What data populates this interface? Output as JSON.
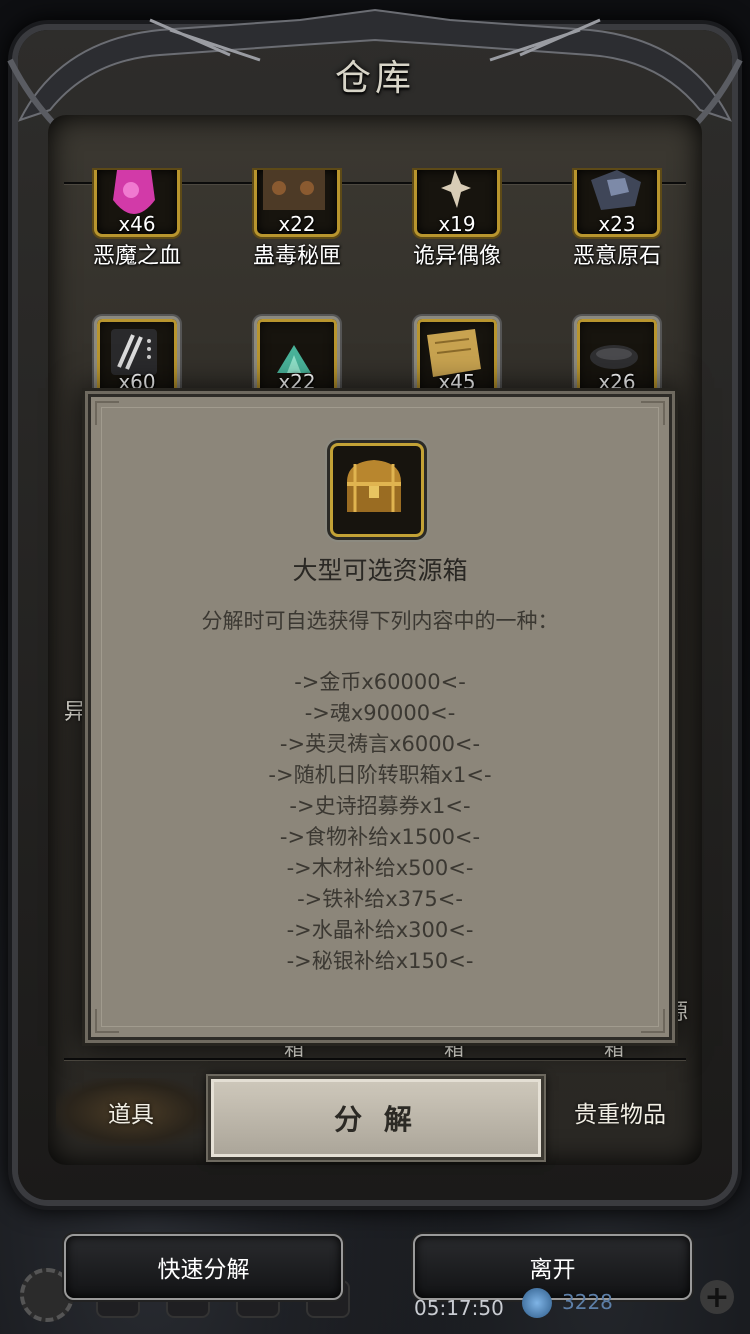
{
  "warehouse": {
    "title": "仓库",
    "top_row_items": [
      {
        "name": "恶魔之血",
        "count": "x46",
        "icon": "demon-blood-icon",
        "color": "#d23aa8"
      },
      {
        "name": "蛊毒秘匣",
        "count": "x22",
        "icon": "poison-box-icon",
        "color": "#6a4a2a"
      },
      {
        "name": "诡异偶像",
        "count": "x19",
        "icon": "idol-icon",
        "color": "#c9b9a0"
      },
      {
        "name": "恶意原石",
        "count": "x23",
        "icon": "ore-icon",
        "color": "#5a6680"
      }
    ],
    "second_row_items": [
      {
        "count": "x60",
        "icon": "claw-scroll-icon",
        "color": "#cfcfcf"
      },
      {
        "count": "x22",
        "icon": "crystal-pile-icon",
        "color": "#49b39a"
      },
      {
        "count": "x45",
        "icon": "map-scroll-icon",
        "color": "#c8a350"
      },
      {
        "count": "x26",
        "icon": "stone-icon",
        "color": "#444444"
      }
    ],
    "partial_labels": {
      "left_mid": "异",
      "right_bottom": "源",
      "bottom_1": "箱",
      "bottom_2": "箱",
      "bottom_3": "箱"
    },
    "tabs": {
      "items": "道具",
      "decompose": "分 解",
      "valuables": "贵重物品"
    }
  },
  "popup": {
    "title": "大型可选资源箱",
    "description": "分解时可自选获得下列内容中的一种：",
    "options": [
      "->金币x60000<-",
      "->魂x90000<-",
      "->英灵祷言x6000<-",
      "->随机日阶转职箱x1<-",
      "->史诗招募券x1<-",
      "->食物补给x1500<-",
      "->木材补给x500<-",
      "->铁补给x375<-",
      "->水晶补给x300<-",
      "->秘银补给x150<-"
    ],
    "icon": "treasure-chest-icon"
  },
  "bottom_bar": {
    "quick_decompose": "快速分解",
    "leave": "离开",
    "time": "05:17:50",
    "gems": "3228"
  }
}
